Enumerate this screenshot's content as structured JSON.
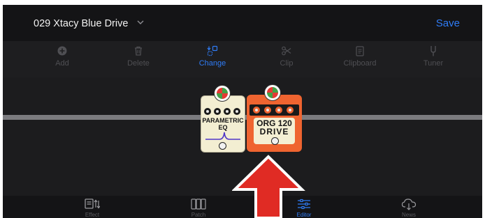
{
  "header": {
    "patch_name": "029 Xtacy Blue Drive",
    "save_label": "Save"
  },
  "toolbar": {
    "add": "Add",
    "delete": "Delete",
    "change": "Change",
    "clip": "Clip",
    "clipboard": "Clipboard",
    "tuner": "Tuner",
    "active": "change"
  },
  "pedals": {
    "eq_label_1": "PARAMETRIC",
    "eq_label_2": "EQ",
    "drive_label_1": "ORG 120",
    "drive_label_2": "DRIVE"
  },
  "nav": {
    "effect": "Effect",
    "patch": "Patch",
    "editor": "Editor",
    "news": "News",
    "active": "editor"
  },
  "colors": {
    "accent": "#2f7cf6",
    "arrow": "#e02b24",
    "drive_pedal": "#ef6430",
    "eq_pedal": "#f3eed2"
  },
  "icons": [
    "chevron-down-icon",
    "plus-circle-icon",
    "trash-icon",
    "change-icon",
    "scissors-icon",
    "clipboard-icon",
    "tuner-icon",
    "effect-icon",
    "patch-icon",
    "editor-icon",
    "cloud-download-icon"
  ]
}
